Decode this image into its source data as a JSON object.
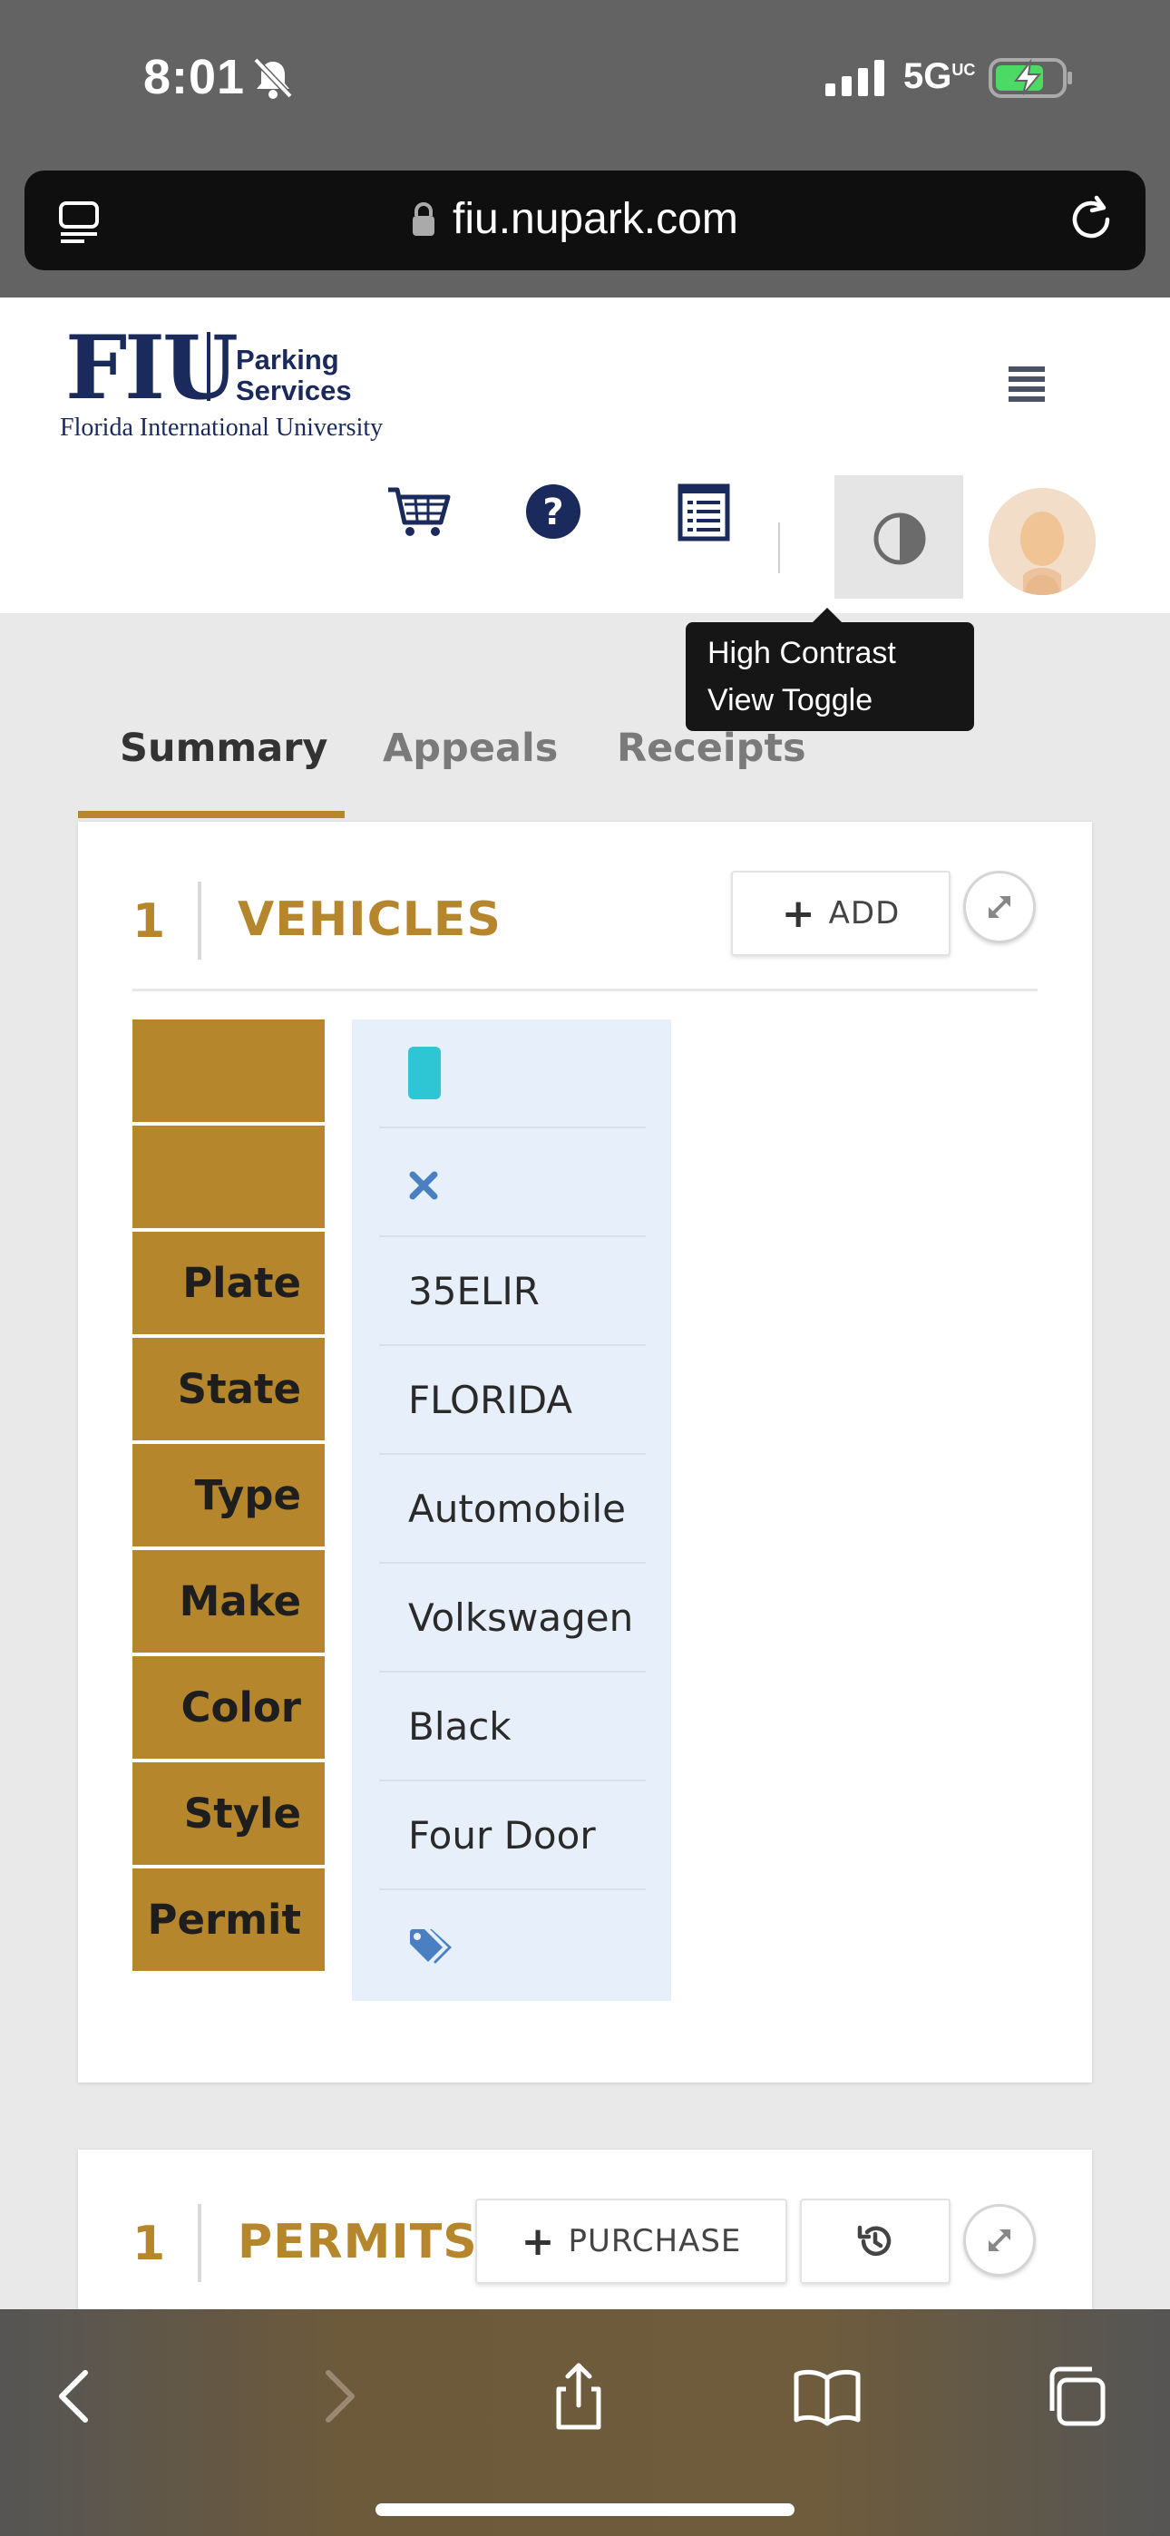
{
  "status_bar": {
    "time": "8:01",
    "network": "5G",
    "network_sup": "UC"
  },
  "browser": {
    "url": "fiu.nupark.com"
  },
  "header": {
    "logo_text": "FIU",
    "logo_subtitle_1": "Parking",
    "logo_subtitle_2": "Services",
    "logo_university": "Florida International University",
    "tooltip_line_1": "High Contrast",
    "tooltip_line_2": "View Toggle"
  },
  "tabs": [
    {
      "label": "Summary",
      "active": true
    },
    {
      "label": "Appeals",
      "active": false
    },
    {
      "label": "Receipts",
      "active": false
    }
  ],
  "vehicles": {
    "count": "1",
    "title": "VEHICLES",
    "add_label": "ADD",
    "status_color": "#2ec6d4",
    "rows": [
      {
        "label": "",
        "value": "",
        "icon": "status-swatch"
      },
      {
        "label": "",
        "value": "",
        "icon": "close-icon"
      },
      {
        "label": "Plate",
        "value": "35ELIR"
      },
      {
        "label": "State",
        "value": "FLORIDA"
      },
      {
        "label": "Type",
        "value": "Automobile"
      },
      {
        "label": "Make",
        "value": "Volkswagen"
      },
      {
        "label": "Color",
        "value": "Black"
      },
      {
        "label": "Style",
        "value": "Four Door"
      },
      {
        "label": "Permit",
        "value": "",
        "icon": "tags-icon"
      }
    ]
  },
  "permits": {
    "count": "1",
    "title": "PERMITS",
    "purchase_label": "PURCHASE"
  },
  "colors": {
    "accent_gold": "#b5862b",
    "navy": "#1a2a5c",
    "table_value_bg": "#e7f0fa",
    "icon_blue": "#4a7fc1"
  }
}
